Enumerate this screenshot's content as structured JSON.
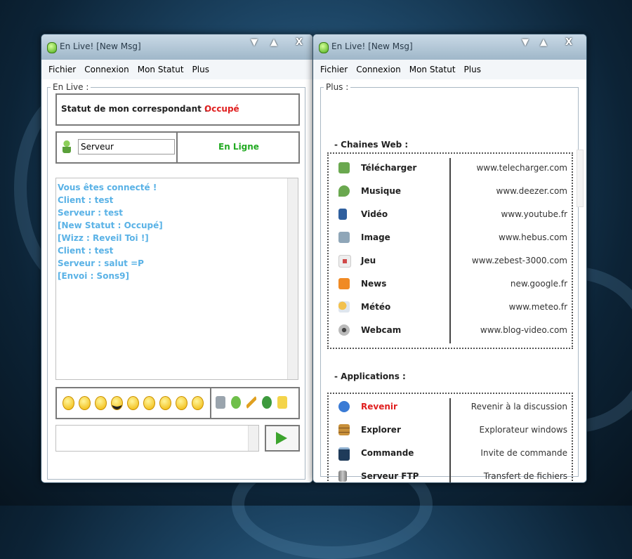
{
  "left_window": {
    "title": "En Live! [New Msg]",
    "menu": [
      "Fichier",
      "Connexion",
      "Mon Statut",
      "Plus"
    ],
    "group_label": "En Live :",
    "status_label": "Statut de mon correspondant :",
    "status_value": "Occupé",
    "server_field": "Serveur",
    "online_text": "En Ligne",
    "chat_lines": [
      "Vous êtes connecté !",
      "Client : test",
      "Serveur : test",
      "[New Statut : Occupé]",
      "[Wizz : Reveil Toi !]",
      "Client : test",
      "Serveur : salut =P",
      "[Envoi : Sons9]"
    ],
    "send_icon": "arrow-right-icon"
  },
  "right_window": {
    "title": "En Live! [New Msg]",
    "menu": [
      "Fichier",
      "Connexion",
      "Mon Statut",
      "Plus"
    ],
    "group_label": "Plus :",
    "web_section": "- Chaines Web :",
    "web_items": [
      {
        "label": "Télécharger",
        "url": "www.telecharger.com",
        "icon": "puzzle-icon",
        "color": "#6aa84f"
      },
      {
        "label": "Musique",
        "url": "www.deezer.com",
        "icon": "music-note-icon",
        "color": "#6aa84f"
      },
      {
        "label": "Vidéo",
        "url": "www.youtube.fr",
        "icon": "video-player-icon",
        "color": "#2f5f9e"
      },
      {
        "label": "Image",
        "url": "www.hebus.com",
        "icon": "picture-icon",
        "color": "#8fa6b8"
      },
      {
        "label": "Jeu",
        "url": "www.zebest-3000.com",
        "icon": "game-icon",
        "color": "#d04a4a"
      },
      {
        "label": "News",
        "url": "new.google.fr",
        "icon": "rss-icon",
        "color": "#f08a24"
      },
      {
        "label": "Météo",
        "url": "www.meteo.fr",
        "icon": "weather-icon",
        "color": "#f2c14e"
      },
      {
        "label": "Webcam",
        "url": "www.blog-video.com",
        "icon": "webcam-icon",
        "color": "#8a8a8a"
      }
    ],
    "app_section": "- Applications :",
    "app_items": [
      {
        "label": "Revenir",
        "url": "Revenir à la discussion",
        "icon": "speech-bubble-icon",
        "color": "#3a7bd5"
      },
      {
        "label": "Explorer",
        "url": "Explorateur windows",
        "icon": "cabinet-icon",
        "color": "#c8903a"
      },
      {
        "label": "Commande",
        "url": "Invite de commande",
        "icon": "terminal-icon",
        "color": "#1f3b5a"
      },
      {
        "label": "Serveur FTP",
        "url": "Transfert de fichiers",
        "icon": "server-icon",
        "color": "#9a9a9a"
      }
    ]
  },
  "colors": {
    "status": "#e02020",
    "online": "#22aa22",
    "chat": "#5ab2e6",
    "revenir": "#e02020"
  }
}
